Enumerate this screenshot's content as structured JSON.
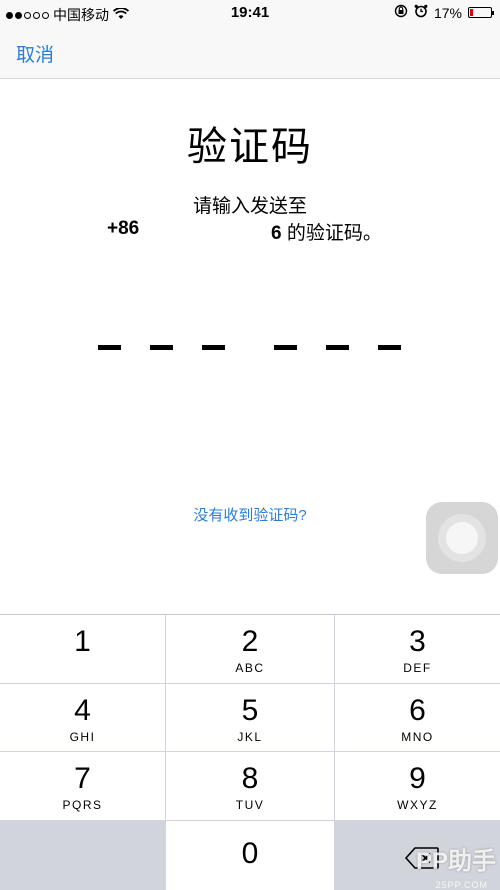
{
  "status_bar": {
    "signal_dots": [
      true,
      true,
      false,
      false,
      false
    ],
    "carrier": "中国移动",
    "wifi_icon": "wifi-icon",
    "time": "19:41",
    "lock_icon": "rotation-lock-icon",
    "alarm_icon": "alarm-clock-icon",
    "battery_percent": "17%",
    "battery_level": 0.17
  },
  "nav": {
    "cancel_label": "取消"
  },
  "main": {
    "title": "验证码",
    "message_line1": "请输入发送至",
    "phone_prefix": "+86",
    "phone_suffix_digit": "6",
    "message_line2_tail": " 的验证码。",
    "code_slots": 6,
    "resend_link": "没有收到验证码?"
  },
  "assistive_touch": {
    "icon": "assistive-touch-icon"
  },
  "keypad": {
    "keys": [
      {
        "digit": "1",
        "letters": ""
      },
      {
        "digit": "2",
        "letters": "ABC"
      },
      {
        "digit": "3",
        "letters": "DEF"
      },
      {
        "digit": "4",
        "letters": "GHI"
      },
      {
        "digit": "5",
        "letters": "JKL"
      },
      {
        "digit": "6",
        "letters": "MNO"
      },
      {
        "digit": "7",
        "letters": "PQRS"
      },
      {
        "digit": "8",
        "letters": "TUV"
      },
      {
        "digit": "9",
        "letters": "WXYZ"
      }
    ],
    "zero": {
      "digit": "0"
    },
    "backspace_icon": "backspace-icon"
  },
  "watermark": {
    "text": "PP助手",
    "sub": "25PP.COM"
  },
  "colors": {
    "accent": "#2a7fd4",
    "keypad_bg": "#d1d5db",
    "bar_bg": "#f8f8f8"
  }
}
